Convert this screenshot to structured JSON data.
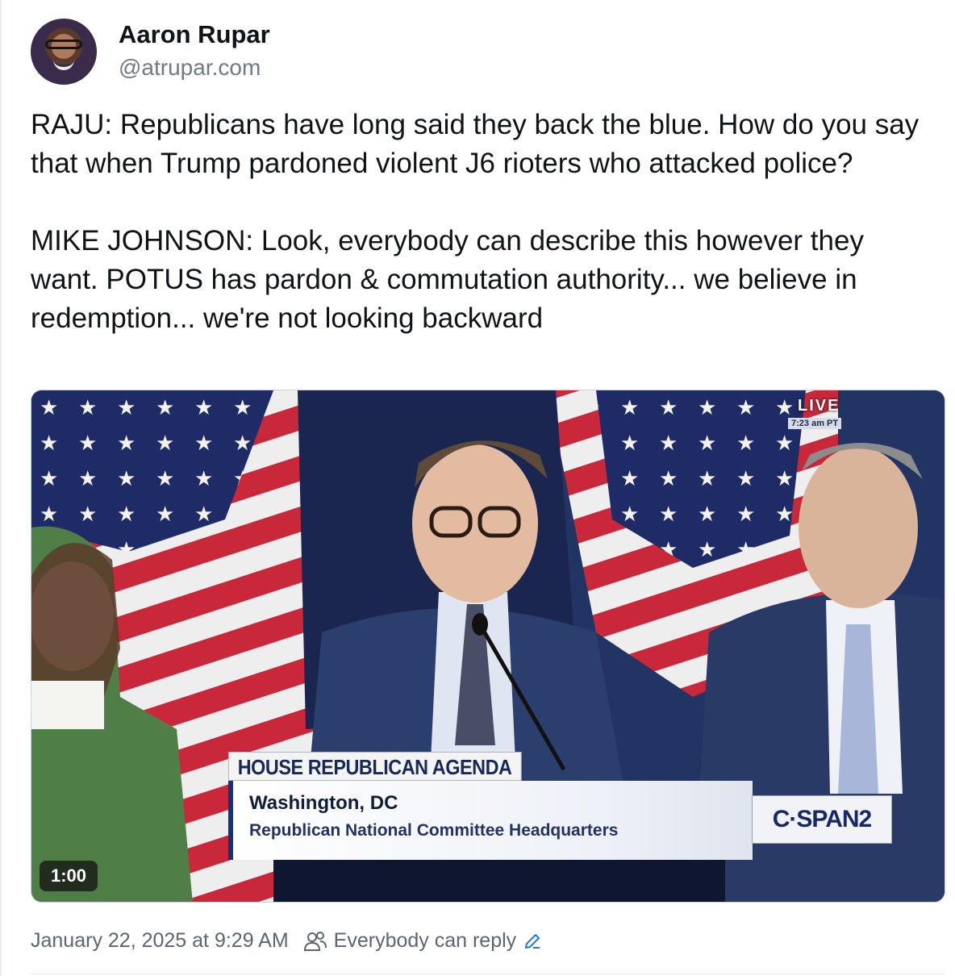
{
  "author": {
    "name": "Aaron Rupar",
    "handle": "@atrupar.com"
  },
  "post": {
    "paragraphs": [
      "RAJU: Republicans have long said they back the blue. How do you say that when Trump pardoned violent J6 rioters who attacked police?",
      "MIKE JOHNSON: Look, everybody can describe this however they want. POTUS has pardon & commutation authority... we believe in redemption... we're not looking backward"
    ]
  },
  "video": {
    "duration": "1:00",
    "live_label": "LIVE",
    "live_time": "7:23 am PT",
    "lower_third_title": "HOUSE REPUBLICAN AGENDA",
    "location_line1": "Washington, DC",
    "location_line2": "Republican National Committee Headquarters",
    "network_logo": "C·SPAN2"
  },
  "footer": {
    "timestamp": "January 22, 2025 at 9:29 AM",
    "reply_setting": "Everybody can reply",
    "icons": [
      "users-icon",
      "pencil-icon"
    ]
  },
  "colors": {
    "link_accent": "#1d7be5",
    "muted_text": "#5b6672"
  }
}
